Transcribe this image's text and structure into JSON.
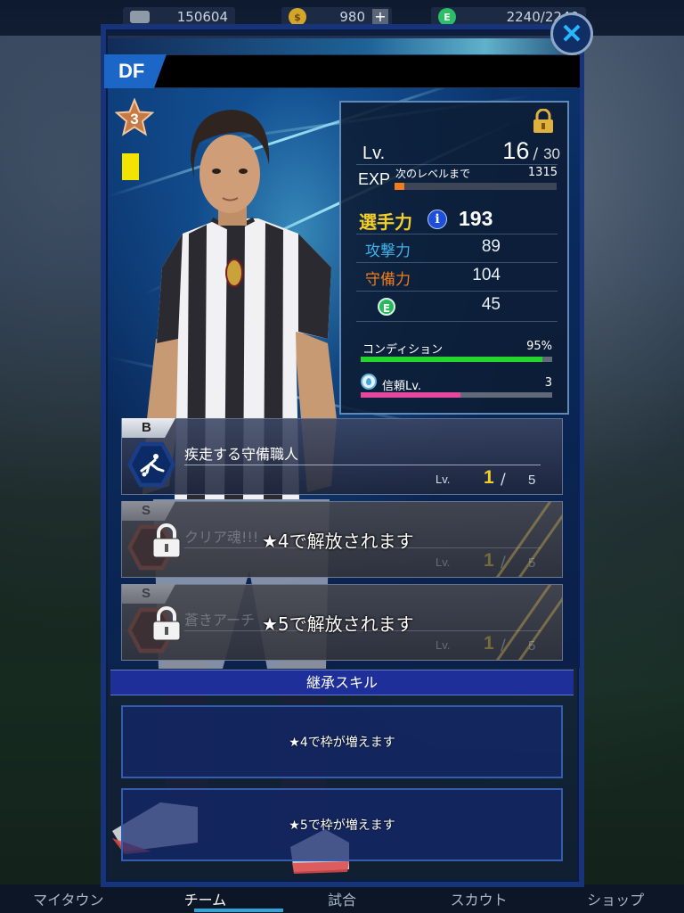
{
  "topbar": {
    "money": "150604",
    "coins": "980",
    "coin_add": "+",
    "energy": "2240/2240"
  },
  "panel": {
    "position": "DF",
    "close": "✕",
    "rarity_stars": "3"
  },
  "stats": {
    "lv_label": "Lv.",
    "lv_current": "16",
    "lv_sep": "/",
    "lv_max": "30",
    "exp_label": "EXP",
    "exp_next_label": "次のレベルまで",
    "exp_next_value": "1315",
    "exp_progress": 0.06,
    "power_label": "選手力",
    "power_value": "193",
    "attack_label": "攻撃力",
    "attack_value": "89",
    "defense_label": "守備力",
    "defense_value": "104",
    "energy_value": "45",
    "condition_label": "コンディション",
    "condition_value": "95%",
    "condition_progress": 0.95,
    "trust_label": "信頼Lv.",
    "trust_value": "3",
    "trust_progress": 0.52
  },
  "skills": [
    {
      "rank": "B",
      "name": "疾走する守備職人",
      "lv_label": "Lv.",
      "lv": "1",
      "sep": "/",
      "max": "5",
      "locked": false,
      "lock_message": ""
    },
    {
      "rank": "S",
      "name": "クリア魂!!!",
      "lv_label": "Lv.",
      "lv": "1",
      "sep": "/",
      "max": "5",
      "locked": true,
      "lock_message": "★4で解放されます"
    },
    {
      "rank": "S",
      "name": "蒼きアーチ",
      "lv_label": "Lv.",
      "lv": "1",
      "sep": "/",
      "max": "5",
      "locked": true,
      "lock_message": "★5で解放されます"
    }
  ],
  "inherit": {
    "header": "継承スキル",
    "slots": [
      "★4で枠が増えます",
      "★5で枠が増えます"
    ]
  },
  "bottomnav": [
    "マイタウン",
    "チーム",
    "試合",
    "スカウト",
    "ショップ"
  ],
  "colors": {
    "accent_blue": "#1c66c8",
    "power_gold": "#f4cf2a",
    "attack_blue": "#3fb3ea",
    "defense_orange": "#f07c1c",
    "condition_green": "#23d52c",
    "trust_pink": "#e6489e"
  }
}
